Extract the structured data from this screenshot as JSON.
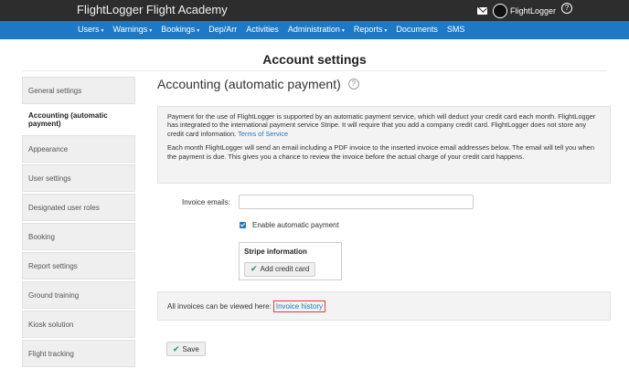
{
  "header": {
    "brand": "FlightLogger Flight Academy",
    "user_name": "FlightLogger",
    "help_glyph": "?"
  },
  "nav": {
    "items": [
      {
        "label": "Users",
        "dropdown": true
      },
      {
        "label": "Warnings",
        "dropdown": true
      },
      {
        "label": "Bookings",
        "dropdown": true
      },
      {
        "label": "Dep/Arr",
        "dropdown": false
      },
      {
        "label": "Activities",
        "dropdown": false
      },
      {
        "label": "Administration",
        "dropdown": true
      },
      {
        "label": "Reports",
        "dropdown": true
      },
      {
        "label": "Documents",
        "dropdown": false
      },
      {
        "label": "SMS",
        "dropdown": false
      }
    ]
  },
  "page": {
    "title": "Account settings"
  },
  "sidebar": {
    "items": [
      {
        "label": "General settings",
        "active": false
      },
      {
        "label": "Accounting (automatic payment)",
        "active": true
      },
      {
        "label": "Appearance",
        "active": false
      },
      {
        "label": "User settings",
        "active": false
      },
      {
        "label": "Designated user roles",
        "active": false
      },
      {
        "label": "Booking",
        "active": false
      },
      {
        "label": "Report settings",
        "active": false
      },
      {
        "label": "Ground training",
        "active": false
      },
      {
        "label": "Kiosk solution",
        "active": false
      },
      {
        "label": "Flight tracking",
        "active": false
      }
    ]
  },
  "content": {
    "section_title": "Accounting (automatic payment)",
    "info_paragraph_1": "Payment for the use of FlightLogger is supported by an automatic payment service, which will deduct your credit card each month. FlightLogger has integrated to the international payment service Stripe. It will require that you add a company credit card. FlightLogger does not store any credit card information.",
    "terms_link": "Terms of Service",
    "info_paragraph_2": "Each month FlightLogger will send an email including a PDF invoice to the inserted invoice email addresses below. The email will tell you when the payment is due. This gives you a chance to review the invoice before the actual charge of your credit card happens.",
    "invoice_emails_label": "Invoice emails:",
    "invoice_emails_value": "",
    "enable_payment_label": "Enable automatic payment",
    "enable_payment_checked": true,
    "stripe_title": "Stripe information",
    "add_card_label": "Add credit card",
    "invoices_text": "All invoices can be viewed here:",
    "invoice_history_link": "Invoice history",
    "save_label": "Save"
  },
  "colors": {
    "topbar": "#2d2d2d",
    "navbar": "#1d79c5",
    "link": "#1d79c5",
    "highlight_border": "#e23c3c"
  }
}
